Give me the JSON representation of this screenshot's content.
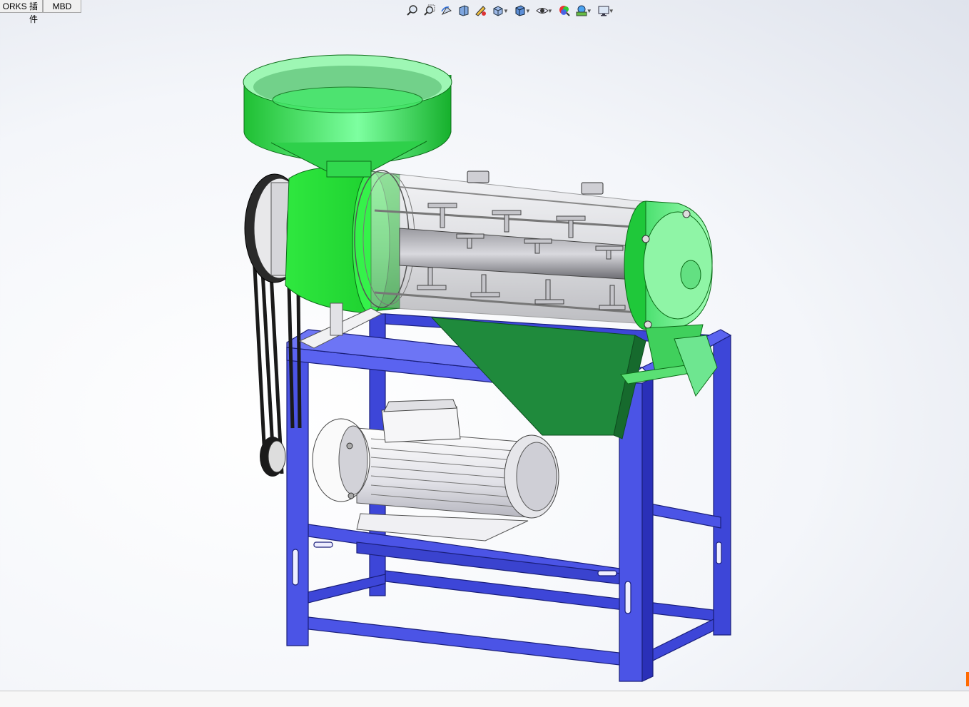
{
  "tabs": [
    {
      "label": "ORKS 插件"
    },
    {
      "label": "MBD"
    }
  ],
  "toolbar": {
    "icons": [
      "zoom-to-fit-icon",
      "zoom-to-area-icon",
      "previous-view-icon",
      "section-view-icon",
      "dynamic-annotation-icon",
      "view-orientation-icon",
      "display-style-icon",
      "hide-show-items-icon",
      "edit-appearance-icon",
      "apply-scene-icon",
      "view-settings-icon"
    ]
  },
  "colors": {
    "frame": "#4b54e6",
    "frame_dark": "#2a30b8",
    "body_green": "#27e03a",
    "hopper_green": "#2fd24a",
    "chute_green": "#1f8a3c",
    "motor": "#e9e9ee",
    "belt": "#1a1a1a"
  }
}
